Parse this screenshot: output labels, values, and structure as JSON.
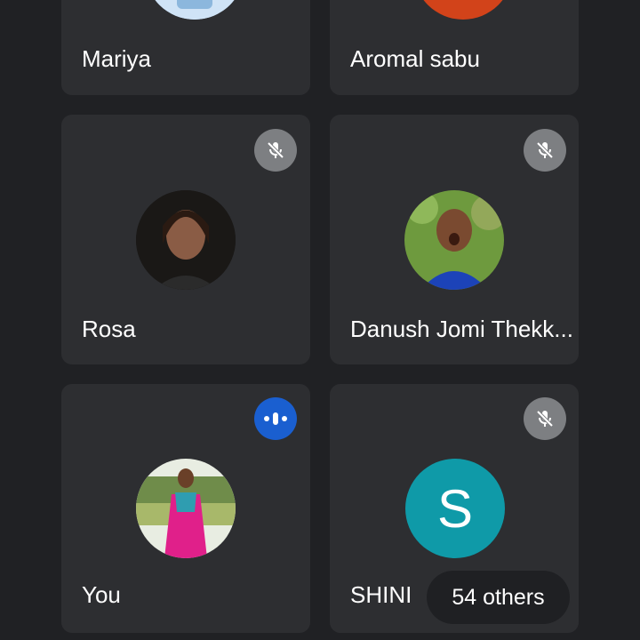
{
  "tiles": [
    {
      "name": "Mariya"
    },
    {
      "name": "Aromal sabu"
    },
    {
      "name": "Rosa",
      "muted": true
    },
    {
      "name": "Danush Jomi Thekk...",
      "muted": true
    },
    {
      "name": "You",
      "speaking": true
    },
    {
      "name": "SHINI",
      "initial": "S",
      "muted": true
    }
  ],
  "others_label": "54 others",
  "colors": {
    "background": "#202124",
    "tile": "#2d2e31",
    "mute_badge": "#7d7f82",
    "speaking_badge": "#1a5fd0",
    "letter_avatar": "#0f9aa8",
    "orange_avatar": "#d2431a"
  }
}
